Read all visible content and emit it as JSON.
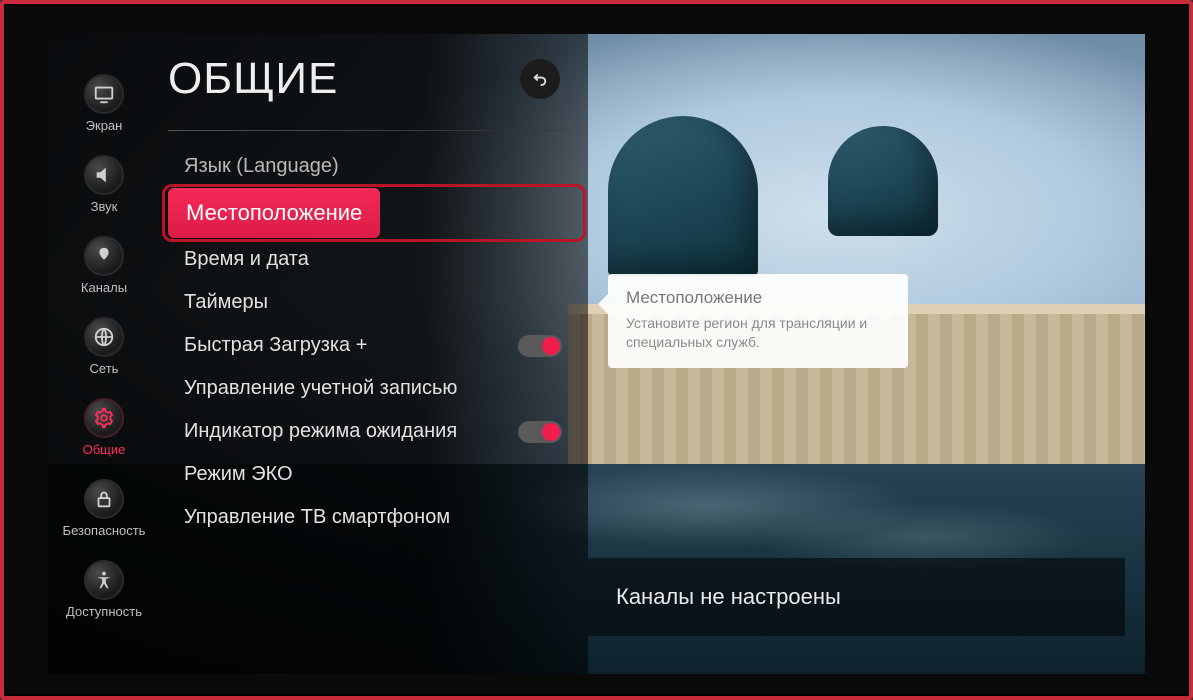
{
  "page_title": "ОБЩИЕ",
  "sidebar": {
    "items": [
      {
        "label": "Экран",
        "icon": "screen"
      },
      {
        "label": "Звук",
        "icon": "sound"
      },
      {
        "label": "Каналы",
        "icon": "channels"
      },
      {
        "label": "Сеть",
        "icon": "network"
      },
      {
        "label": "Общие",
        "icon": "general",
        "active": true
      },
      {
        "label": "Безопасность",
        "icon": "lock"
      },
      {
        "label": "Доступность",
        "icon": "accessibility"
      }
    ]
  },
  "menu": {
    "items": [
      {
        "label": "Язык (Language)",
        "truncated": true
      },
      {
        "label": "Местоположение",
        "selected": true
      },
      {
        "label": "Время и дата"
      },
      {
        "label": "Таймеры"
      },
      {
        "label": "Быстрая Загрузка +",
        "toggle": true
      },
      {
        "label": "Управление учетной записью"
      },
      {
        "label": "Индикатор режима ожидания",
        "toggle": true
      },
      {
        "label": "Режим ЭКО"
      },
      {
        "label": "Управление ТВ смартфоном"
      }
    ]
  },
  "tooltip": {
    "title": "Местоположение",
    "desc": "Установите регион для трансляции и специальных служб."
  },
  "toast": {
    "text": "Каналы не настроены"
  }
}
